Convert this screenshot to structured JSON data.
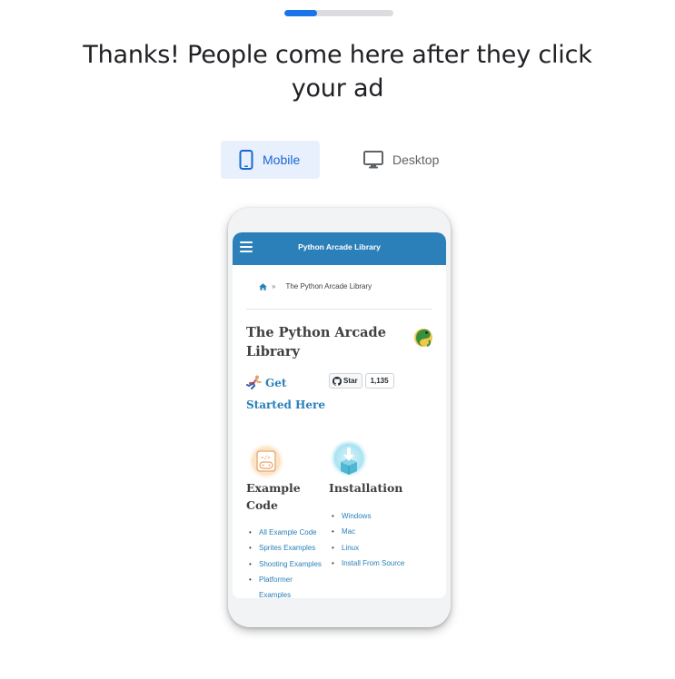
{
  "progress": {
    "fraction": 0.3,
    "color": "#1a73e8",
    "track_color": "#dadce0"
  },
  "headline": "Thanks! People come here after they click your ad",
  "toggle": {
    "mobile": {
      "label": "Mobile",
      "icon": "smartphone-icon",
      "selected": true
    },
    "desktop": {
      "label": "Desktop",
      "icon": "desktop-icon",
      "selected": false
    }
  },
  "preview": {
    "appbar": {
      "title": "Python Arcade Library",
      "color": "#2b80b9",
      "menu_icon": "hamburger-menu-icon"
    },
    "breadcrumb": {
      "home_icon": "home-icon",
      "separator": "»",
      "current": "The Python Arcade Library"
    },
    "page_title": "The Python Arcade Library",
    "logo_icon": "python-snake-logo-icon",
    "get_started": {
      "label": "Get Started Here",
      "icon": "runner-icon"
    },
    "github": {
      "star_label": "Star",
      "star_count": "1,135",
      "icon": "github-icon"
    },
    "example_code": {
      "heading": "Example Code",
      "icon": "gamepad-code-icon",
      "links": [
        "All Example Code",
        "Sprites Examples",
        "Shooting Examples",
        "Platformer Examples"
      ]
    },
    "installation": {
      "heading": "Installation",
      "icon": "download-box-icon",
      "links": [
        "Windows",
        "Mac",
        "Linux",
        "Install From Source"
      ]
    }
  }
}
